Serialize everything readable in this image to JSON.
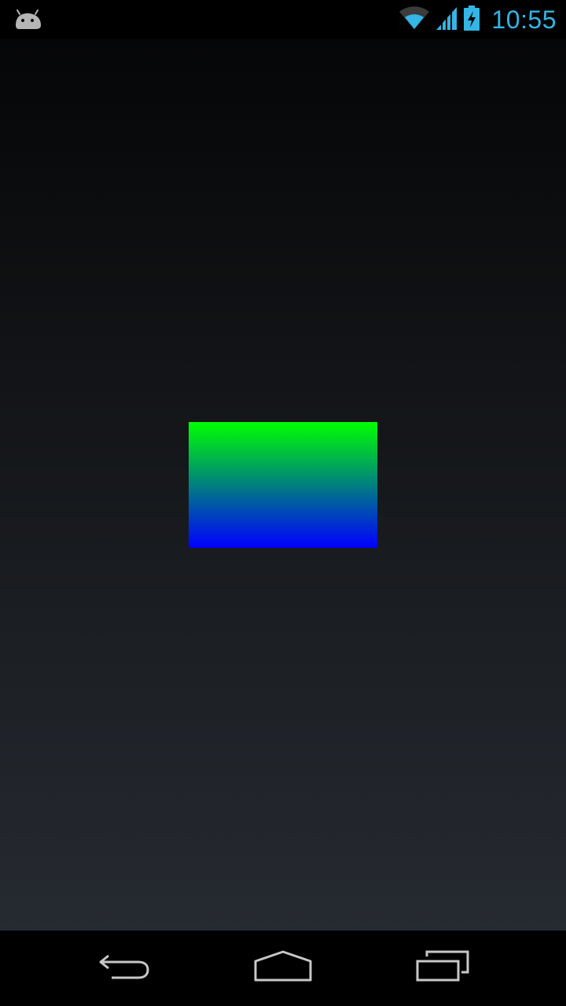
{
  "status_bar": {
    "time": "10:55",
    "notification_icon": "android-icon",
    "wifi_icon": "wifi-icon",
    "signal_icon": "cell-signal-icon",
    "battery_icon": "battery-charging-icon",
    "accent_color": "#33b5e5"
  },
  "content": {
    "gradient_box": {
      "top_color": "#00ff00",
      "bottom_color": "#0000ff"
    }
  },
  "nav_bar": {
    "back_icon": "back-icon",
    "home_icon": "home-icon",
    "recents_icon": "recents-icon"
  }
}
